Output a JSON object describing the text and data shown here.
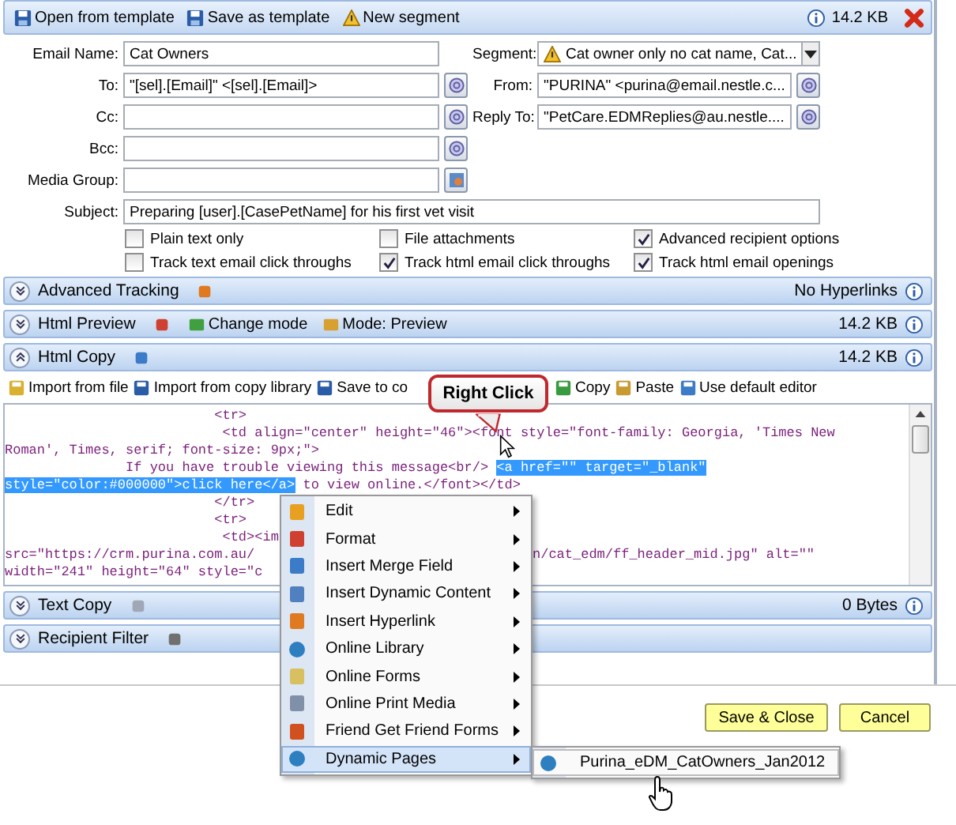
{
  "toolbar": {
    "items": [
      {
        "label": "Open from template"
      },
      {
        "label": "Save as template"
      },
      {
        "label": "New segment"
      }
    ],
    "size": "14.2 KB"
  },
  "form": {
    "rows": [
      {
        "left": {
          "label": "Email Name:",
          "value": "Cat Owners",
          "kind": "text"
        },
        "right": {
          "label": "Segment:",
          "value": "Cat owner only no cat name, Cat...",
          "kind": "dropdown"
        }
      },
      {
        "left": {
          "label": "To:",
          "value": "\"[sel].[Email]\" <[sel].[Email]>",
          "kind": "address"
        },
        "right": {
          "label": "From:",
          "value": "\"PURINA\" <purina@email.nestle.c...",
          "kind": "address"
        }
      },
      {
        "left": {
          "label": "Cc:",
          "kind": "address"
        },
        "right": {
          "label": "Reply To:",
          "value": "\"PetCare.EDMReplies@au.nestle....",
          "kind": "address"
        }
      },
      {
        "left": {
          "label": "Bcc:",
          "kind": "address"
        }
      },
      {
        "left": {
          "label": "Media Group:",
          "kind": "media"
        }
      }
    ],
    "subject": {
      "label": "Subject:",
      "value": "Preparing [user].[CasePetName] for his first vet visit"
    },
    "options": [
      {
        "label": "Plain text only",
        "checked": false
      },
      {
        "label": "File attachments",
        "checked": false
      },
      {
        "label": "Advanced recipient options",
        "checked": true
      },
      {
        "label": "Track text email click throughs",
        "checked": false
      },
      {
        "label": "Track html email click throughs",
        "checked": true
      },
      {
        "label": "Track html email openings",
        "checked": true
      }
    ]
  },
  "sections": [
    {
      "title": "Advanced Tracking",
      "expanded": false,
      "right": "No Hyperlinks"
    },
    {
      "title": "Html Preview",
      "expanded": false,
      "tools": [
        {
          "label": "Change mode"
        },
        {
          "label": "Mode: Preview"
        }
      ],
      "right": "14.2 KB"
    },
    {
      "title": "Html Copy",
      "expanded": true,
      "right": "14.2 KB",
      "toolbar": [
        {
          "label": "Import from file"
        },
        {
          "label": "Import from copy library"
        },
        {
          "label": "Save to co"
        },
        {
          "label": "Copy"
        },
        {
          "label": "Paste"
        },
        {
          "label": "Use default editor"
        }
      ],
      "code": [
        {
          "segments": [
            {
              "text": "                          <tr>",
              "selected": false
            }
          ]
        },
        {
          "segments": [
            {
              "text": "                           <td align=\"center\" height=\"46\"><font style=\"font-family: Georgia, 'Times New",
              "selected": false
            }
          ]
        },
        {
          "segments": [
            {
              "text": "Roman', Times, serif; font-size: 9px;\">",
              "selected": false
            }
          ]
        },
        {
          "segments": [
            {
              "text": "               If you have trouble viewing this message<br/> ",
              "selected": false
            },
            {
              "text": "<a href=\"\" target=\"_blank\"",
              "selected": true
            }
          ]
        },
        {
          "segments": [
            {
              "text": "style=\"color:#000000\">click here</a>",
              "selected": true
            },
            {
              "text": " to view online.</font></td>",
              "selected": false
            }
          ]
        },
        {
          "segments": [
            {
              "text": "                          </tr>",
              "selected": false
            }
          ]
        },
        {
          "segments": [
            {
              "text": "                          <tr>",
              "selected": false
            }
          ]
        },
        {
          "segments": [
            {
              "text": "                           <td><im",
              "selected": false
            }
          ]
        },
        {
          "segments": [
            {
              "text": "src=\"https://crm.purina.com.au/",
              "selected": false
            }
          ],
          "right": "n/cat_edm/ff_header_mid.jpg\" alt=\"\""
        },
        {
          "segments": [
            {
              "text": "width=\"241\" height=\"64\" style=\"c",
              "selected": false
            }
          ]
        }
      ]
    },
    {
      "title": "Text Copy",
      "expanded": false,
      "right": "0 Bytes"
    },
    {
      "title": "Recipient Filter",
      "expanded": false
    }
  ],
  "buttons": [
    "Save & Close",
    "Cancel"
  ],
  "callout": "Right Click",
  "context_menu": {
    "items": [
      {
        "label": "Edit",
        "selected": false
      },
      {
        "label": "Format",
        "selected": false
      },
      {
        "label": "Insert Merge Field",
        "selected": false
      },
      {
        "label": "Insert Dynamic Content",
        "selected": false
      },
      {
        "label": "Insert Hyperlink",
        "selected": false
      },
      {
        "label": "Online Library",
        "selected": false
      },
      {
        "label": "Online Forms",
        "selected": false
      },
      {
        "label": "Online Print Media",
        "selected": false
      },
      {
        "label": "Friend Get Friend Forms",
        "selected": false
      },
      {
        "label": "Dynamic Pages",
        "selected": true
      }
    ],
    "submenu": [
      {
        "label": "Purina_eDM_CatOwners_Jan2012",
        "selected": true
      }
    ]
  }
}
